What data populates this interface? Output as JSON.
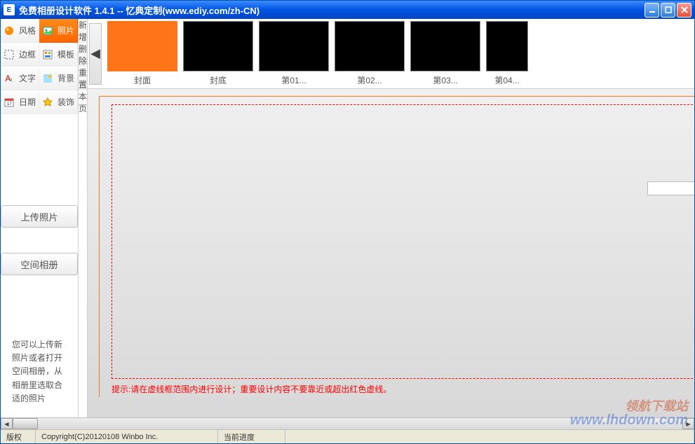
{
  "titlebar": {
    "icon_letter": "E",
    "text": "免费相册设计软件 1.4.1 -- 忆典定制(www.ediy.com/zh-CN)"
  },
  "tools": {
    "style": "风格",
    "photo": "照片",
    "border": "边框",
    "template": "模板",
    "text": "文字",
    "background": "背景",
    "date": "日期",
    "decoration": "装饰"
  },
  "upload": {
    "upload_btn": "上传照片",
    "album_btn": "空间相册",
    "help": "您可以上传新照片或者打开空间相册，从相册里选取合适的照片"
  },
  "actions": {
    "add_page": "新增一页",
    "delete_page": "删除本页",
    "reset_page": "重置本页"
  },
  "thumbs": [
    {
      "label": "封面",
      "cover": true
    },
    {
      "label": "封底"
    },
    {
      "label": "第01..."
    },
    {
      "label": "第02..."
    },
    {
      "label": "第03..."
    },
    {
      "label": "第04..."
    }
  ],
  "canvas": {
    "hint": "提示:请在虚线框范围内进行设计；重要设计内容不要靠近或超出红色虚线。"
  },
  "statusbar": {
    "copyright_label": "版权",
    "copyright_text": "Copyright(C)20120108 Winbo Inc.",
    "progress_label": "当前进度"
  },
  "watermark": {
    "line1": "领航下载站",
    "line2": "www.lhdown.com"
  }
}
